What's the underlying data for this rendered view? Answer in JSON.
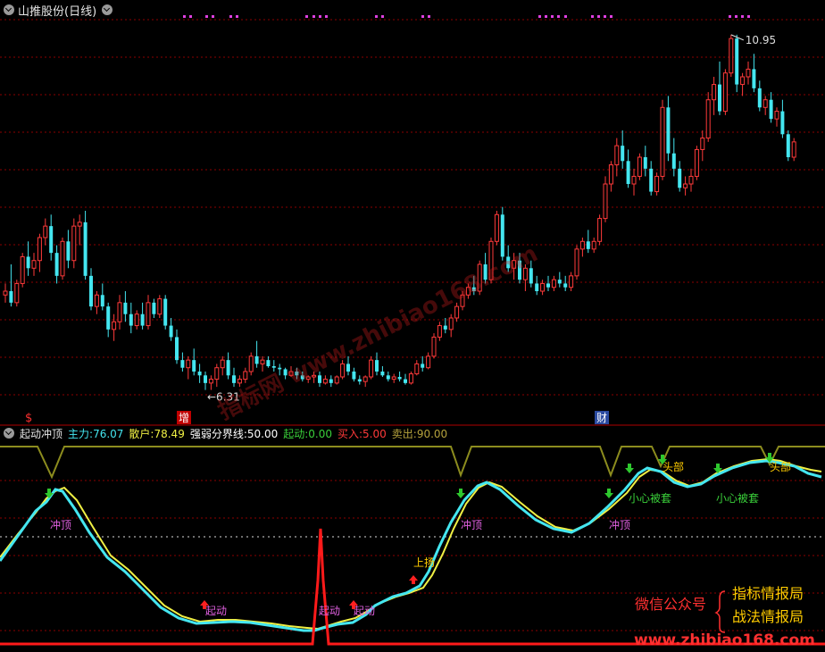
{
  "window": {
    "title": "山推股份(日线)"
  },
  "price_panel": {
    "high_label": "10.95",
    "low_label": "6.31",
    "markers": [
      {
        "text": "$",
        "color": "#ff3030"
      },
      {
        "text": "增",
        "color": "#ffffff"
      },
      {
        "text": "财",
        "color": "#ffffff"
      }
    ],
    "watermark": "指标网 www.zhibiao168.com"
  },
  "indicator_header": {
    "name": "起动冲顶",
    "items": [
      {
        "label": "主力:",
        "value": "76.07",
        "color": "#44e6f0"
      },
      {
        "label": "散户:",
        "value": "78.49",
        "color": "#f0f044"
      },
      {
        "label": "强弱分界线:",
        "value": "50.00",
        "color": "#ffffff"
      },
      {
        "label": "起动:",
        "value": "0.00",
        "color": "#3ad03a"
      },
      {
        "label": "买入:",
        "value": "5.00",
        "color": "#ff3a3a"
      },
      {
        "label": "卖出:",
        "value": "90.00",
        "color": "#b5a23c"
      }
    ]
  },
  "annotations": {
    "chongding": "冲顶",
    "qidong": "起动",
    "shangyang": "上扬",
    "toubu": "头部",
    "xiaoxin": "小心被套"
  },
  "promo": {
    "left": "微信公众号",
    "right_top": "指标情报局",
    "right_bottom": "战法情报局",
    "url": "www.zhibiao168.com"
  },
  "colors": {
    "up": "#ff3a3a",
    "down": "#44e6f0",
    "grid": "#8b0000",
    "main_line": "#44e6f0",
    "retail_line": "#f0f044",
    "sell_line": "#8c8c1e",
    "buy_line": "#ff1a1a",
    "dots": "#e040e0"
  },
  "chart_data": {
    "type": "candlestick",
    "title": "山推股份(日线)",
    "price_range": [
      6.31,
      10.95
    ],
    "candles": [
      [
        7.55,
        7.7,
        7.45,
        7.6
      ],
      [
        7.6,
        7.95,
        7.4,
        7.45
      ],
      [
        7.45,
        7.75,
        7.4,
        7.7
      ],
      [
        7.7,
        8.1,
        7.65,
        8.05
      ],
      [
        8.05,
        8.25,
        7.8,
        7.9
      ],
      [
        7.9,
        8.1,
        7.8,
        8.0
      ],
      [
        8.0,
        8.35,
        7.85,
        8.3
      ],
      [
        8.3,
        8.55,
        8.2,
        8.45
      ],
      [
        8.45,
        8.6,
        8.0,
        8.1
      ],
      [
        8.1,
        8.2,
        7.7,
        7.8
      ],
      [
        7.8,
        8.3,
        7.75,
        8.25
      ],
      [
        8.25,
        8.4,
        7.9,
        8.0
      ],
      [
        8.0,
        8.55,
        7.9,
        8.45
      ],
      [
        8.45,
        8.6,
        8.2,
        8.5
      ],
      [
        8.5,
        8.65,
        7.75,
        7.8
      ],
      [
        7.8,
        7.9,
        7.35,
        7.4
      ],
      [
        7.4,
        7.6,
        7.3,
        7.55
      ],
      [
        7.55,
        7.7,
        7.35,
        7.4
      ],
      [
        7.4,
        7.45,
        7.0,
        7.1
      ],
      [
        7.1,
        7.3,
        6.95,
        7.2
      ],
      [
        7.2,
        7.55,
        7.1,
        7.45
      ],
      [
        7.45,
        7.6,
        7.2,
        7.3
      ],
      [
        7.3,
        7.45,
        7.05,
        7.15
      ],
      [
        7.15,
        7.35,
        7.1,
        7.3
      ],
      [
        7.3,
        7.45,
        7.1,
        7.15
      ],
      [
        7.15,
        7.55,
        7.1,
        7.45
      ],
      [
        7.45,
        7.5,
        7.25,
        7.3
      ],
      [
        7.3,
        7.55,
        7.25,
        7.5
      ],
      [
        7.5,
        7.55,
        7.1,
        7.15
      ],
      [
        7.15,
        7.25,
        6.95,
        7.0
      ],
      [
        7.0,
        7.1,
        6.65,
        6.7
      ],
      [
        6.7,
        6.8,
        6.55,
        6.6
      ],
      [
        6.6,
        6.75,
        6.45,
        6.7
      ],
      [
        6.7,
        6.85,
        6.5,
        6.55
      ],
      [
        6.55,
        6.65,
        6.4,
        6.5
      ],
      [
        6.5,
        6.55,
        6.31,
        6.4
      ],
      [
        6.4,
        6.5,
        6.31,
        6.45
      ],
      [
        6.45,
        6.65,
        6.35,
        6.6
      ],
      [
        6.6,
        6.75,
        6.5,
        6.7
      ],
      [
        6.7,
        6.8,
        6.45,
        6.5
      ],
      [
        6.5,
        6.6,
        6.35,
        6.4
      ],
      [
        6.4,
        6.5,
        6.35,
        6.45
      ],
      [
        6.45,
        6.6,
        6.4,
        6.55
      ],
      [
        6.55,
        6.8,
        6.5,
        6.75
      ],
      [
        6.75,
        6.95,
        6.6,
        6.65
      ],
      [
        6.65,
        6.75,
        6.55,
        6.7
      ],
      [
        6.7,
        6.75,
        6.6,
        6.62
      ],
      [
        6.62,
        6.7,
        6.55,
        6.6
      ],
      [
        6.6,
        6.65,
        6.5,
        6.58
      ],
      [
        6.58,
        6.6,
        6.45,
        6.5
      ],
      [
        6.5,
        6.62,
        6.48,
        6.55
      ],
      [
        6.55,
        6.6,
        6.45,
        6.5
      ],
      [
        6.5,
        6.55,
        6.42,
        6.45
      ],
      [
        6.45,
        6.5,
        6.4,
        6.48
      ],
      [
        6.48,
        6.55,
        6.4,
        6.5
      ],
      [
        6.5,
        6.55,
        6.35,
        6.4
      ],
      [
        6.4,
        6.5,
        6.38,
        6.45
      ],
      [
        6.45,
        6.5,
        6.35,
        6.4
      ],
      [
        6.4,
        6.5,
        6.38,
        6.48
      ],
      [
        6.48,
        6.7,
        6.45,
        6.65
      ],
      [
        6.65,
        6.75,
        6.5,
        6.55
      ],
      [
        6.55,
        6.6,
        6.42,
        6.45
      ],
      [
        6.45,
        6.5,
        6.38,
        6.42
      ],
      [
        6.42,
        6.5,
        6.35,
        6.48
      ],
      [
        6.48,
        6.75,
        6.45,
        6.7
      ],
      [
        6.7,
        6.8,
        6.5,
        6.55
      ],
      [
        6.55,
        6.62,
        6.48,
        6.5
      ],
      [
        6.5,
        6.55,
        6.42,
        6.45
      ],
      [
        6.45,
        6.52,
        6.4,
        6.48
      ],
      [
        6.48,
        6.55,
        6.42,
        6.45
      ],
      [
        6.45,
        6.52,
        6.38,
        6.4
      ],
      [
        6.4,
        6.55,
        6.38,
        6.52
      ],
      [
        6.52,
        6.7,
        6.5,
        6.65
      ],
      [
        6.65,
        6.75,
        6.55,
        6.6
      ],
      [
        6.6,
        6.8,
        6.58,
        6.75
      ],
      [
        6.75,
        7.05,
        6.72,
        7.0
      ],
      [
        7.0,
        7.2,
        6.95,
        7.15
      ],
      [
        7.15,
        7.25,
        7.05,
        7.1
      ],
      [
        7.1,
        7.3,
        7.0,
        7.25
      ],
      [
        7.25,
        7.45,
        7.2,
        7.4
      ],
      [
        7.4,
        7.6,
        7.35,
        7.55
      ],
      [
        7.55,
        7.7,
        7.5,
        7.65
      ],
      [
        7.65,
        7.8,
        7.55,
        7.6
      ],
      [
        7.6,
        8.0,
        7.55,
        7.95
      ],
      [
        7.95,
        8.1,
        7.7,
        7.75
      ],
      [
        7.75,
        8.3,
        7.7,
        8.25
      ],
      [
        8.25,
        8.65,
        8.2,
        8.6
      ],
      [
        8.6,
        8.7,
        8.0,
        8.05
      ],
      [
        8.05,
        8.2,
        7.85,
        7.9
      ],
      [
        7.9,
        8.1,
        7.75,
        8.0
      ],
      [
        8.0,
        8.1,
        7.7,
        7.75
      ],
      [
        7.75,
        7.95,
        7.6,
        7.9
      ],
      [
        7.9,
        8.0,
        7.65,
        7.7
      ],
      [
        7.7,
        7.8,
        7.55,
        7.6
      ],
      [
        7.6,
        7.75,
        7.55,
        7.7
      ],
      [
        7.7,
        7.8,
        7.6,
        7.65
      ],
      [
        7.65,
        7.8,
        7.6,
        7.75
      ],
      [
        7.75,
        7.85,
        7.65,
        7.7
      ],
      [
        7.7,
        7.8,
        7.6,
        7.65
      ],
      [
        7.65,
        7.85,
        7.6,
        7.8
      ],
      [
        7.8,
        8.2,
        7.75,
        8.15
      ],
      [
        8.15,
        8.3,
        8.05,
        8.25
      ],
      [
        8.25,
        8.4,
        8.1,
        8.15
      ],
      [
        8.15,
        8.3,
        8.1,
        8.25
      ],
      [
        8.25,
        8.6,
        8.2,
        8.55
      ],
      [
        8.55,
        9.1,
        8.5,
        9.0
      ],
      [
        9.0,
        9.3,
        8.9,
        9.25
      ],
      [
        9.25,
        9.6,
        9.1,
        9.5
      ],
      [
        9.5,
        9.7,
        9.2,
        9.3
      ],
      [
        9.3,
        9.45,
        8.95,
        9.0
      ],
      [
        9.0,
        9.2,
        8.85,
        9.1
      ],
      [
        9.1,
        9.4,
        9.05,
        9.35
      ],
      [
        9.35,
        9.5,
        9.1,
        9.2
      ],
      [
        9.2,
        9.3,
        8.85,
        8.9
      ],
      [
        8.9,
        9.15,
        8.85,
        9.1
      ],
      [
        9.1,
        10.1,
        9.05,
        10.0
      ],
      [
        10.0,
        10.15,
        9.3,
        9.4
      ],
      [
        9.4,
        9.6,
        9.1,
        9.2
      ],
      [
        9.2,
        9.3,
        8.9,
        8.95
      ],
      [
        8.95,
        9.1,
        8.85,
        9.0
      ],
      [
        9.0,
        9.2,
        8.9,
        9.1
      ],
      [
        9.1,
        9.5,
        9.05,
        9.45
      ],
      [
        9.45,
        9.7,
        9.3,
        9.6
      ],
      [
        9.6,
        10.2,
        9.55,
        10.1
      ],
      [
        10.1,
        10.4,
        9.9,
        10.3
      ],
      [
        10.3,
        10.6,
        9.9,
        9.95
      ],
      [
        9.95,
        10.5,
        9.9,
        10.45
      ],
      [
        10.45,
        10.95,
        10.4,
        10.9
      ],
      [
        10.9,
        10.95,
        10.2,
        10.3
      ],
      [
        10.3,
        10.45,
        10.15,
        10.4
      ],
      [
        10.4,
        10.6,
        10.3,
        10.5
      ],
      [
        10.5,
        10.7,
        10.2,
        10.25
      ],
      [
        10.25,
        10.35,
        9.95,
        10.0
      ],
      [
        10.0,
        10.15,
        9.9,
        10.1
      ],
      [
        10.1,
        10.2,
        9.8,
        9.85
      ],
      [
        9.85,
        10.0,
        9.75,
        9.95
      ],
      [
        9.95,
        10.1,
        9.6,
        9.65
      ],
      [
        9.65,
        9.7,
        9.3,
        9.35
      ],
      [
        9.35,
        9.6,
        9.3,
        9.55
      ]
    ],
    "indicator": {
      "title": "起动冲顶",
      "main_force": 76.07,
      "retail": 78.49,
      "threshold": 50.0,
      "start": 0.0,
      "buy": 5.0,
      "sell": 90.0,
      "legend": [
        "主力",
        "散户",
        "强弱分界线",
        "起动",
        "买入",
        "卖出"
      ]
    }
  }
}
